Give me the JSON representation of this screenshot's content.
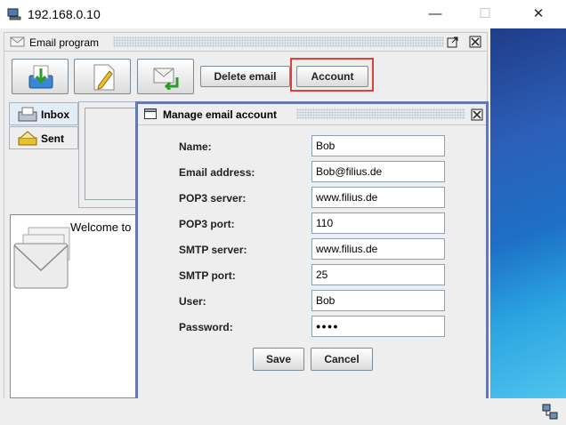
{
  "window": {
    "title": "192.168.0.10",
    "minimize": "—",
    "maximize": "☐",
    "close": "✕"
  },
  "frame": {
    "title": "Email program",
    "toolbar": {
      "delete_label": "Delete email",
      "account_label": "Account"
    },
    "tabs": [
      {
        "label": "Inbox"
      },
      {
        "label": "Sent"
      }
    ],
    "welcome_text": "Welcome to"
  },
  "dialog": {
    "title": "Manage email account",
    "fields": [
      {
        "label": "Name:",
        "value": "Bob"
      },
      {
        "label": "Email address:",
        "value": "Bob@filius.de"
      },
      {
        "label": "POP3 server:",
        "value": "www.filius.de"
      },
      {
        "label": "POP3 port:",
        "value": "110"
      },
      {
        "label": "SMTP server:",
        "value": "www.filius.de"
      },
      {
        "label": "SMTP port:",
        "value": "25"
      },
      {
        "label": "User:",
        "value": "Bob"
      },
      {
        "label": "Password:",
        "value": "●●●●"
      }
    ],
    "save_label": "Save",
    "cancel_label": "Cancel"
  },
  "colors": {
    "highlight": "#e0403a",
    "dialog_border": "#6678b3"
  }
}
